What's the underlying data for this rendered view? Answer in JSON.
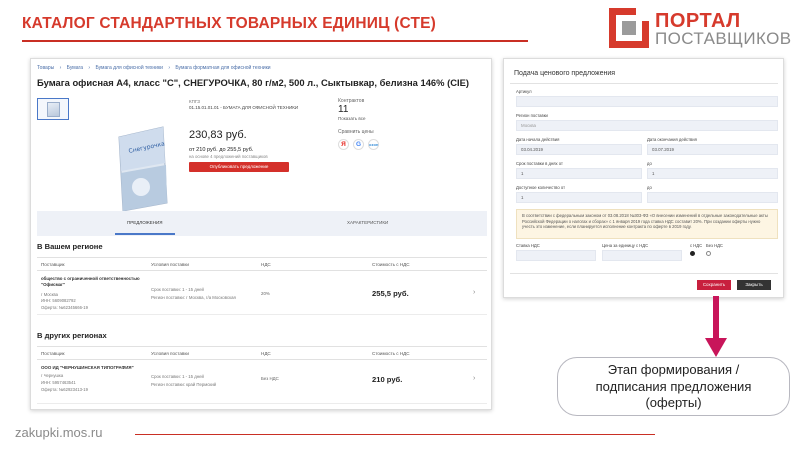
{
  "slide": {
    "title": "КАТАЛОГ СТАНДАРТНЫХ ТОВАРНЫХ ЕДИНИЦ (СТЕ)",
    "footer_url": "zakupki.mos.ru",
    "callout": [
      "Этап формирования /",
      "подписания предложения",
      "(оферты)"
    ]
  },
  "logo": {
    "line1": "ПОРТАЛ",
    "line2": "ПОСТАВЩИКОВ",
    "accent": "#d63a2c"
  },
  "catalog": {
    "breadcrumbs": [
      "Товары",
      "›",
      "Бумага",
      "›",
      "Бумага для офисной техники",
      "›",
      "Бумага форматная для офисной техники"
    ],
    "product_title": "Бумага офисная А4, класс \"С\", СНЕГУРОЧКА, 80 г/м2, 500 л., Сыктывкар, белизна 146% (CIE)",
    "kpgz_label": "КПГЗ",
    "kpgz_value": "01.15.01.01.01 - БУМАГА ДЛЯ ОФИСНОЙ ТЕХНИКИ",
    "price": "230,83 руб.",
    "price_range": "от 210 руб. до 255,5 руб.",
    "price_note": "на основе 4 предложений поставщиков",
    "offer_button": "Опубликовать предложение",
    "contracts_label": "Контрактов",
    "contracts_count": "11",
    "show_all": "Показать все",
    "compare_label": "Сравнить цены",
    "compare_icons": [
      {
        "icon": "yandex-icon",
        "glyph": "Я"
      },
      {
        "icon": "google-icon",
        "glyph": "G"
      },
      {
        "icon": "ozon-icon",
        "glyph": "ozon"
      }
    ],
    "tabs": [
      "ПРЕДЛОЖЕНИЯ",
      "ХАРАКТЕРИСТИКИ"
    ],
    "active_tab": 0,
    "table_headers": [
      "Поставщик",
      "Условия поставки",
      "НДС",
      "Стоимость с НДС"
    ],
    "region_title": "В Вашем регионе",
    "other_title": "В других регионах",
    "region_rows": [
      {
        "name": "общество с ограниченной ответственностью \"Офисмаг\"",
        "city": "г Москва",
        "inn": "ИНН: 5609082792",
        "offer": "Оферта: №62345666-19",
        "term": "Срок поставки: 1 - 15 дней",
        "region": "Регион поставки: г Москва, г/а Московская",
        "vat": "20%",
        "cost": "255,5 руб."
      }
    ],
    "other_rows": [
      {
        "name": "ООО ИД \"ЧЕРНУШИНСКАЯ ТИПОГРАФИЯ\"",
        "city": "г Чернушка",
        "inn": "ИНН: 5957463541",
        "offer": "Оферта: №62923413-19",
        "term": "Срок поставки: 1 - 15 дней",
        "region": "Регион поставки: край Пермский",
        "vat": "Без НДС",
        "cost": "210 руб."
      }
    ]
  },
  "bid_form": {
    "title": "Подача ценового предложения",
    "article_label": "Артикул",
    "region_label": "Регион поставки",
    "region_placeholder": "Москва",
    "start_label": "Дата начала действия",
    "start_value": "03.04.2019",
    "end_label": "Дата окончания действия",
    "end_value": "03.07.2019",
    "term_label": "Срок поставки в днях от",
    "term_from": "1",
    "to_label": "до",
    "term_to": "1",
    "qty_label": "Доступное количество от",
    "qty_from": "1",
    "qty_to_label": "до",
    "qty_to": "",
    "info_text": "В соответствии с федеральным законом от 03.08.2018 №303-ФЗ «О внесении изменений в отдельные законодательные акты Российской Федерации о налогах и сборах» с 1 января 2019 года ставка НДС составит 20%. При создании оферты нужно учесть это изменение, если планируется исполнение контракта по оферте в 2019 году.",
    "vat_rate_label": "Ставка НДС",
    "unit_price_label": "Цена за единицу с НДС",
    "with_vat": "с НДС",
    "without_vat": "Без НДС",
    "save_button": "Сохранить",
    "close_button": "Закрыть"
  },
  "colors": {
    "brand_red": "#d63a2c",
    "button_red": "#d4302a",
    "save_red": "#c8203e",
    "tab_blue": "#4a78c8",
    "arrow_magenta": "#c8155a"
  }
}
